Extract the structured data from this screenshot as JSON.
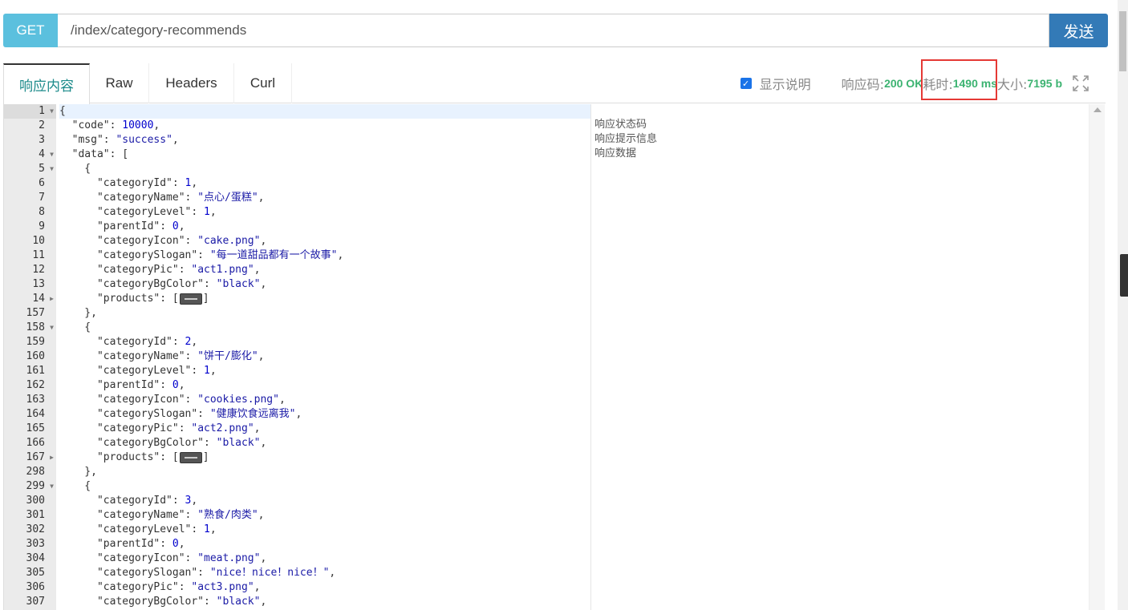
{
  "request": {
    "method": "GET",
    "url": "/index/category-recommends",
    "send_label": "发送"
  },
  "tabs": [
    "响应内容",
    "Raw",
    "Headers",
    "Curl"
  ],
  "meta": {
    "show_desc_label": "显示说明",
    "show_desc_checked": true,
    "code_label": "响应码:",
    "code_value": "200 OK",
    "time_label": "耗时:",
    "time_value": "1490 ms",
    "size_label": "大小:",
    "size_value": "7195 b"
  },
  "line_numbers": [
    "1",
    "2",
    "3",
    "4",
    "5",
    "6",
    "7",
    "8",
    "9",
    "10",
    "11",
    "12",
    "13",
    "14",
    "157",
    "158",
    "159",
    "160",
    "161",
    "162",
    "163",
    "164",
    "165",
    "166",
    "167",
    "298",
    "299",
    "300",
    "301",
    "302",
    "303",
    "304",
    "305",
    "306",
    "307"
  ],
  "code_lines": [
    "{",
    "  \"code\": 10000,",
    "  \"msg\": \"success\",",
    "  \"data\": [",
    "    {",
    "      \"categoryId\": 1,",
    "      \"categoryName\": \"点心/蛋糕\",",
    "      \"categoryLevel\": 1,",
    "      \"parentId\": 0,",
    "      \"categoryIcon\": \"cake.png\",",
    "      \"categorySlogan\": \"每一道甜品都有一个故事\",",
    "      \"categoryPic\": \"act1.png\",",
    "      \"categoryBgColor\": \"black\",",
    "      \"products\": [",
    "    },",
    "    {",
    "      \"categoryId\": 2,",
    "      \"categoryName\": \"饼干/膨化\",",
    "      \"categoryLevel\": 1,",
    "      \"parentId\": 0,",
    "      \"categoryIcon\": \"cookies.png\",",
    "      \"categorySlogan\": \"健康饮食远离我\",",
    "      \"categoryPic\": \"act2.png\",",
    "      \"categoryBgColor\": \"black\",",
    "      \"products\": [",
    "    },",
    "    {",
    "      \"categoryId\": 3,",
    "      \"categoryName\": \"熟食/肉类\",",
    "      \"categoryLevel\": 1,",
    "      \"parentId\": 0,",
    "      \"categoryIcon\": \"meat.png\",",
    "      \"categorySlogan\": \"nice！nice！nice！\",",
    "      \"categoryPic\": \"act3.png\",",
    "      \"categoryBgColor\": \"black\","
  ],
  "descriptions": [
    "响应状态码",
    "响应提示信息",
    "响应数据"
  ],
  "colors": {
    "method_bg": "#5bc0de",
    "send_bg": "#337ab7",
    "active_tab_text": "#1b8a8a",
    "meta_value": "#3cb371",
    "highlight": "#e53935"
  }
}
